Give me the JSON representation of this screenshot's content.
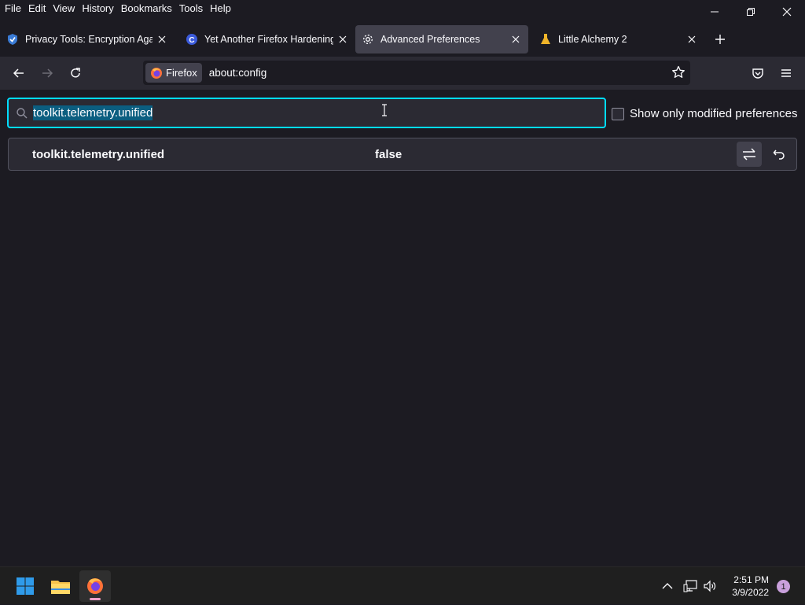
{
  "menubar": {
    "items": [
      "File",
      "Edit",
      "View",
      "History",
      "Bookmarks",
      "Tools",
      "Help"
    ]
  },
  "tabs": [
    {
      "title": "Privacy Tools: Encryption Agains",
      "icon": "shield-icon",
      "selected": false
    },
    {
      "title": "Yet Another Firefox Hardening G",
      "icon": "c-logo-icon",
      "selected": false
    },
    {
      "title": "Advanced Preferences",
      "icon": "gear-icon",
      "selected": true
    },
    {
      "title": "Little Alchemy 2",
      "icon": "flask-icon",
      "selected": false
    }
  ],
  "urlbar": {
    "identity_label": "Firefox",
    "url": "about:config"
  },
  "config": {
    "search_value": "toolkit.telemetry.unified",
    "show_modified_label": "Show only modified preferences",
    "show_modified_checked": false,
    "preferences": [
      {
        "name": "toolkit.telemetry.unified",
        "value": "false"
      }
    ]
  },
  "taskbar": {
    "time": "2:51 PM",
    "date": "3/9/2022",
    "notification_count": "1"
  },
  "colors": {
    "accent_focus": "#00ddff",
    "selection": "#0b5e80",
    "background": "#1c1b22",
    "toolbar": "#2b2a33"
  }
}
